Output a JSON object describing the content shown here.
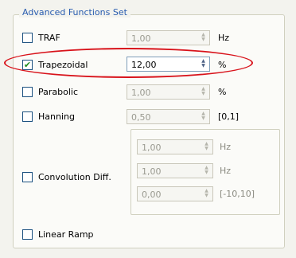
{
  "group": {
    "title": "Advanced Functions Set"
  },
  "rows": {
    "traf": {
      "label": "TRAF",
      "checked": false,
      "value": "1,00",
      "unit": "Hz"
    },
    "trapezoidal": {
      "label": "Trapezoidal",
      "checked": true,
      "value": "12,00",
      "unit": "%"
    },
    "parabolic": {
      "label": "Parabolic",
      "checked": false,
      "value": "1,00",
      "unit": "%"
    },
    "hanning": {
      "label": "Hanning",
      "checked": false,
      "value": "0,50",
      "unit": "[0,1]"
    },
    "convolution": {
      "label": "Convolution Diff.",
      "checked": false,
      "fields": [
        {
          "value": "1,00",
          "unit": "Hz"
        },
        {
          "value": "1,00",
          "unit": "Hz"
        },
        {
          "value": "0,00",
          "unit": "[-10,10]"
        }
      ]
    },
    "linear_ramp": {
      "label": "Linear Ramp",
      "checked": false
    }
  },
  "icons": {
    "checkmark": "✔",
    "spin_up": "▲",
    "spin_down": "▼"
  },
  "colors": {
    "highlight": "#d8121a",
    "legend": "#2a5db0",
    "check": "#1e8c1e"
  }
}
